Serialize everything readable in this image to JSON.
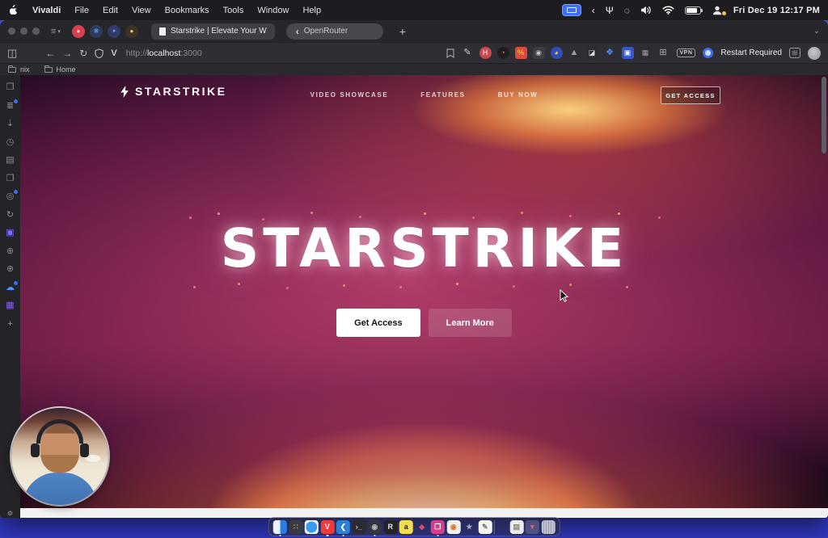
{
  "menubar": {
    "app_name": "Vivaldi",
    "menus": [
      "File",
      "Edit",
      "View",
      "Bookmarks",
      "Tools",
      "Window",
      "Help"
    ],
    "chevron": "‹",
    "input_glyph": "Ψ",
    "circle_glyph": "◌",
    "clock": "Fri Dec 19 12:17 PM"
  },
  "tabbar": {
    "stack_glyph": "≡",
    "stack_caret": "▾",
    "pinned_tabs": [
      {
        "name": "pinned-tab-red-favicon",
        "bg": "#d8404e",
        "fg": "#ffd0d4",
        "glyph": "●"
      },
      {
        "name": "pinned-tab-butterfly-favicon",
        "bg": "#2f3b5c",
        "fg": "#58a6ff",
        "glyph": "❋"
      },
      {
        "name": "pinned-tab-indigo-favicon",
        "bg": "#333a66",
        "fg": "#6f8cff",
        "glyph": "✦"
      },
      {
        "name": "pinned-tab-gold-favicon",
        "bg": "#3a3426",
        "fg": "#e8c35a",
        "glyph": "●"
      }
    ],
    "active_tab_title": "Starstrike | Elevate Your W",
    "openrouter_logo": "‹",
    "openrouter_title": "OpenRouter",
    "new_tab_label": "+",
    "end_caret": "⌄"
  },
  "toolbar": {
    "panel_toggle_glyph": "◫",
    "back_glyph": "←",
    "forward_glyph": "→",
    "reload_glyph": "↻",
    "v_button_glyph": "V",
    "url_scheme": "http://",
    "url_host": "localhost",
    "url_port": ":3000",
    "bookmark_glyph": "⌻",
    "extensions": [
      {
        "name": "pencil-extension-icon",
        "glyph": "✎",
        "bg": "transparent",
        "fg": "#d0d0d6",
        "cls": "bare"
      },
      {
        "name": "red-h-extension-icon",
        "glyph": "H",
        "bg": "#c84a50",
        "fg": "#ffffff",
        "cls": "round"
      },
      {
        "name": "orange-disc-extension-icon",
        "glyph": "◔",
        "bg": "#1e1e22",
        "fg": "#f2923c",
        "cls": "round"
      },
      {
        "name": "percent-extension-icon",
        "glyph": "%",
        "bg": "#d94b3f",
        "fg": "#ffd84d"
      },
      {
        "name": "camera-extension-icon",
        "glyph": "◉",
        "bg": "#3c3c42",
        "fg": "#c4c4ca"
      },
      {
        "name": "blue-yellow-extension-icon",
        "glyph": "◕",
        "bg": "#2d4db8",
        "fg": "#f3c33c",
        "cls": "round"
      },
      {
        "name": "cloud-extension-icon",
        "glyph": "▲",
        "bg": "transparent",
        "fg": "#9aa0a8",
        "cls": "bare"
      },
      {
        "name": "image-extension-icon",
        "glyph": "◪",
        "bg": "#2c2c31",
        "fg": "#d4dae0"
      },
      {
        "name": "compass-extension-icon",
        "glyph": "❖",
        "bg": "transparent",
        "fg": "#4f8ef7",
        "cls": "bare"
      },
      {
        "name": "lock-extension-icon",
        "glyph": "▣",
        "bg": "#3557c9",
        "fg": "#eef2fa"
      },
      {
        "name": "checker-extension-icon",
        "glyph": "▦",
        "bg": "#2c2c31",
        "fg": "#9aa0a8"
      },
      {
        "name": "puzzle-extension-icon",
        "glyph": "⊞",
        "bg": "transparent",
        "fg": "#aab0b8",
        "cls": "bare"
      }
    ],
    "vpn_label": "VPN",
    "restart_label": "Restart Required",
    "box_glyph": "⊞"
  },
  "bookmarksbar": {
    "items": [
      {
        "name": "bookmark-folder-nix",
        "label": "nix"
      },
      {
        "name": "bookmark-folder-home",
        "label": "Home"
      }
    ]
  },
  "panel": {
    "icons": [
      {
        "name": "bookmarks-panel-icon",
        "glyph": "❒",
        "fg": "#8e8e96"
      },
      {
        "name": "reading-list-panel-icon",
        "glyph": "≣",
        "fg": "#8e8e96",
        "badge": true
      },
      {
        "name": "downloads-panel-icon",
        "glyph": "⇣",
        "fg": "#8e8e96"
      },
      {
        "name": "history-panel-icon",
        "glyph": "◷",
        "fg": "#8e8e96"
      },
      {
        "name": "notes-panel-icon",
        "glyph": "▤",
        "fg": "#8e8e96"
      },
      {
        "name": "windows-panel-icon",
        "glyph": "❐",
        "fg": "#8e8e96"
      },
      {
        "name": "tasks-panel-icon",
        "glyph": "◎",
        "fg": "#8e8e96",
        "badge": true
      },
      {
        "name": "sync-panel-icon",
        "glyph": "↻",
        "fg": "#8e8e96"
      },
      {
        "name": "webpanel-purple-icon",
        "glyph": "▣",
        "fg": "#7b6cff"
      },
      {
        "name": "webpanel-globe-icon",
        "glyph": "⊕",
        "fg": "#8a8a92"
      },
      {
        "name": "webpanel-globe2-icon",
        "glyph": "⊕",
        "fg": "#8a8a92"
      },
      {
        "name": "webpanel-cloud-icon",
        "glyph": "☁",
        "fg": "#4a9bff",
        "badge": true
      },
      {
        "name": "webpanel-grid-icon",
        "glyph": "▦",
        "fg": "#8a5cf6"
      },
      {
        "name": "add-panel-icon",
        "glyph": "+",
        "fg": "#9a9aa2"
      }
    ],
    "settings_glyph": "⚙"
  },
  "page": {
    "logo_text": "STARSTRIKE",
    "nav": [
      "VIDEO SHOWCASE",
      "FEATURES",
      "BUY NOW"
    ],
    "header_cta": "GET ACCESS",
    "hero_title": "STARSTRIKE",
    "primary_cta": "Get Access",
    "secondary_cta": "Learn More",
    "accent_colors": {
      "glow_orange": "#ff9840",
      "glow_magenta": "#ce487a",
      "glow_yellow": "#fff3c8"
    }
  },
  "dock": {
    "items": [
      {
        "name": "dock-finder",
        "cls": "ic-finder",
        "glyph": "",
        "bg": "#1e6ef0",
        "fg": "#ffffff",
        "running": true
      },
      {
        "name": "dock-launchpad",
        "glyph": "∷",
        "bg": "#3a3a42",
        "fg": "#e0a43c"
      },
      {
        "name": "dock-safari",
        "cls": "ic-safari",
        "glyph": "",
        "bg": "#f2f4f6",
        "fg": "#2a7de1"
      },
      {
        "name": "dock-vivaldi",
        "glyph": "V",
        "bg": "#ef3b3b",
        "fg": "#ffffff",
        "running": true
      },
      {
        "name": "dock-vscode",
        "glyph": "❮",
        "bg": "#2b80d4",
        "fg": "#ffffff",
        "running": true
      },
      {
        "name": "dock-terminal",
        "glyph": "›_",
        "bg": "#2c2c30",
        "fg": "#cccccc"
      },
      {
        "name": "dock-obs",
        "glyph": "◉",
        "bg": "#32363c",
        "fg": "#aeb4bc",
        "running": true
      },
      {
        "name": "dock-r-app",
        "glyph": "R",
        "bg": "#242428",
        "fg": "#e8e8ec"
      },
      {
        "name": "dock-arc",
        "glyph": "a",
        "bg": "#f2dd4e",
        "fg": "#1a1a1a"
      },
      {
        "name": "dock-color-app",
        "glyph": "◆",
        "bg": "transparent",
        "fg": "#d0506e"
      },
      {
        "name": "dock-book",
        "glyph": "❒",
        "bg": "#d63d8a",
        "fg": "#ffffff",
        "running": true
      },
      {
        "name": "dock-paint",
        "glyph": "◉",
        "bg": "#f0f0ee",
        "fg": "#e0762e"
      },
      {
        "name": "dock-star",
        "glyph": "★",
        "bg": "transparent",
        "fg": "#a8aeb6"
      },
      {
        "name": "dock-notes",
        "glyph": "✎",
        "bg": "#f5f5f0",
        "fg": "#777777"
      },
      {
        "name": "dock-separator",
        "cls": "ic-sep",
        "glyph": "",
        "bg": "transparent",
        "fg": "#ffffff"
      },
      {
        "name": "dock-document",
        "glyph": "▤",
        "bg": "#eeeee8",
        "fg": "#888888"
      },
      {
        "name": "dock-stack",
        "glyph": "▾",
        "bg": "rgba(255,255,255,0.18)",
        "fg": "#d06680"
      },
      {
        "name": "dock-trash",
        "cls": "ic-trash",
        "glyph": "",
        "bg": "rgba(190,195,205,0.75)",
        "fg": "#555555"
      }
    ]
  }
}
